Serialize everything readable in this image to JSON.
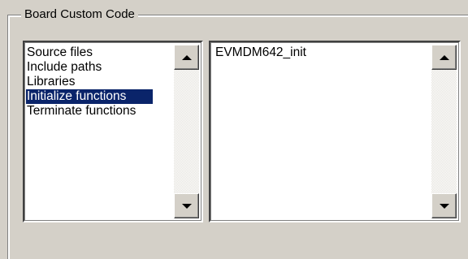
{
  "group": {
    "title": "Board Custom Code"
  },
  "category_list": {
    "items": [
      {
        "label": "Source files",
        "selected": false
      },
      {
        "label": "Include paths",
        "selected": false
      },
      {
        "label": "Libraries",
        "selected": false
      },
      {
        "label": "Initialize functions",
        "selected": true
      },
      {
        "label": "Terminate functions",
        "selected": false
      }
    ]
  },
  "code_list": {
    "items": [
      {
        "label": "EVMDM642_init"
      }
    ]
  },
  "colors": {
    "selection_background": "#0a246a",
    "selection_text": "#ffffff",
    "window_background": "#d4d0c8"
  },
  "icons": {
    "scroll_up": "chevron-up-icon",
    "scroll_down": "chevron-down-icon"
  }
}
